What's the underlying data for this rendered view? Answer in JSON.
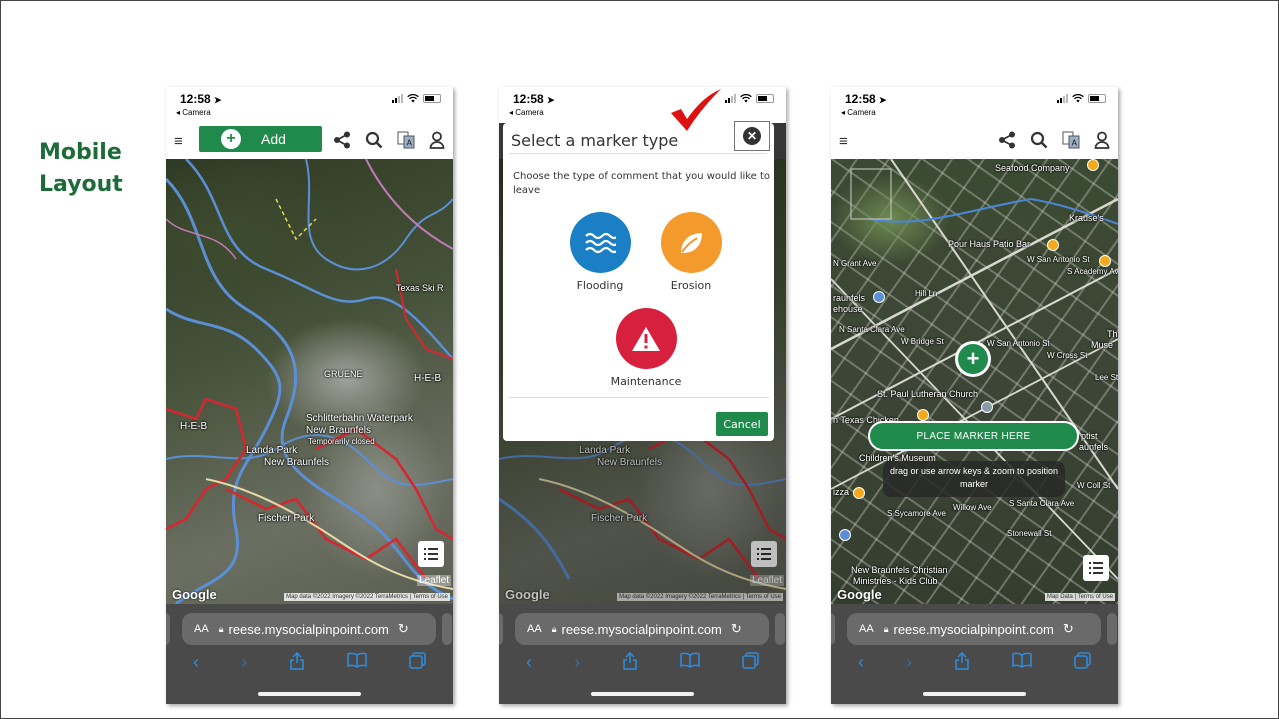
{
  "slide": {
    "side_title": "Mobile Layout"
  },
  "status_bar": {
    "time": "12:58",
    "location_arrow": "➤",
    "back_app": "◂ Camera"
  },
  "toolbar": {
    "add_label": "Add",
    "icons": [
      "menu-icon",
      "share-icon",
      "search-icon",
      "translate-icon",
      "user-icon"
    ]
  },
  "browser": {
    "text_size": "AA",
    "url": "reese.mysocialpinpoint.com",
    "reload": "↻"
  },
  "map1": {
    "labels": [
      "Texas Ski R",
      "GRUENE",
      "H-E-B",
      "Schlitterbahn Waterpark",
      "New Braunfels",
      "Temporarily closed",
      "H-E-B",
      "Landa Park",
      "New Braunfels",
      "Fischer Park"
    ],
    "leaflet": "Leaflet",
    "google": "Google",
    "attribution": "Map data ©2022 Imagery ©2022 TerraMetrics  |  Terms of Use"
  },
  "map2": {
    "labels": [
      "Landa Park",
      "New Braunfels",
      "Fischer Park"
    ]
  },
  "modal": {
    "title": "Select a marker type",
    "description": "Choose the type of comment that you would like to leave",
    "types": [
      {
        "label": "Flooding",
        "color": "#1a7fc4",
        "icon": "water-waves-icon"
      },
      {
        "label": "Erosion",
        "color": "#f49a2c",
        "icon": "leaf-icon"
      },
      {
        "label": "Maintenance",
        "color": "#d7203e",
        "icon": "warning-icon"
      }
    ],
    "cancel": "Cancel"
  },
  "map3": {
    "labels": [
      "Seafood Company",
      "Krause's",
      "Pour Haus Patio Bar",
      "N Grant Ave",
      "W San Antonio St",
      "S Academy Av",
      "raunfels",
      "ehouse",
      "Hill Ln",
      "N Santa Clara Ave",
      "W Bridge St",
      "W San Antonio St",
      "Th",
      "Muse",
      "W Cross St",
      "St. Paul Lutheran Church",
      "Lee St",
      "n Texas Chicken",
      "ptist",
      "aunfels",
      "Children's Museum",
      "izza",
      "Willow Ave",
      "S Sycamore Ave",
      "S Santa Clara Ave",
      "W Coll St",
      "Stonewall St",
      "New Braunfels Christian",
      "Ministries - Kids Club"
    ],
    "place_marker": "PLACE MARKER HERE",
    "hint": "drag or use arrow keys & zoom to position marker",
    "google": "Google",
    "attribution": "Map Data  |  Terms of Use"
  },
  "colors": {
    "brand_green": "#1f8a4c",
    "title_green": "#1e6b3a",
    "ios_blue": "#2e8ce0",
    "check_red": "#d11"
  }
}
